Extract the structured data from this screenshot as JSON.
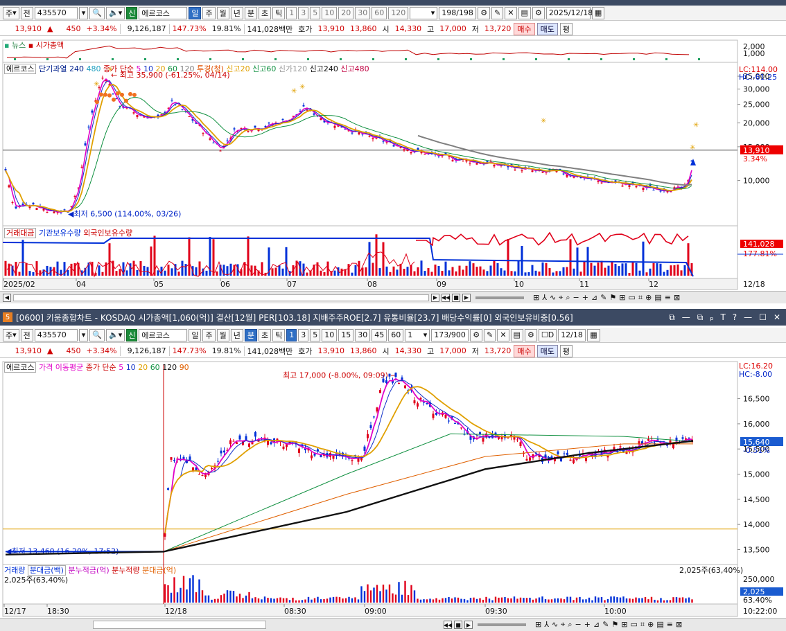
{
  "top": {
    "toolbar": {
      "type": "주",
      "prev": "전",
      "code": "435570",
      "market_badge": "신",
      "name": "에르코스",
      "periods": [
        "일",
        "주",
        "월",
        "년",
        "분",
        "초",
        "틱"
      ],
      "active_period": "일",
      "nums": [
        "1",
        "3",
        "5",
        "10",
        "20",
        "30",
        "60",
        "120"
      ],
      "count": "198/198",
      "date": "2025/12/18"
    },
    "quote": {
      "price": "13,910",
      "arrow": "▲",
      "change": "450",
      "pct": "+3.34%",
      "volume": "9,126,187",
      "vol_ratio": "147.73%",
      "turnover": "19.81%",
      "amount": "141,028백만",
      "hoga_label": "호가",
      "ask": "13,910",
      "bid": "13,860",
      "open_label": "시",
      "open": "14,330",
      "high_label": "고",
      "high": "17,000",
      "low_label": "저",
      "low": "13,720",
      "buy": "매수",
      "sell": "매도",
      "eval": "평"
    },
    "news_panel": {
      "news": "뉴스",
      "mcap": "시가총액",
      "ticks": [
        "2,000",
        "1,000"
      ]
    },
    "legend": {
      "stock": "에르코스",
      "sma": "단기과열",
      "n1": "240",
      "n2": "480",
      "ma_label": "종가 단순",
      "m5": "5",
      "m10": "10",
      "m20": "20",
      "m60": "60",
      "m120": "120",
      "tg": "투경(청)",
      "s20": "신고20",
      "s60": "신고60",
      "s120": "신가120",
      "s240": "신고240",
      "s480": "신고480"
    },
    "right_top": {
      "lc": "LC:114.00",
      "hc": "HC:-61.25"
    },
    "price_ticks": [
      "35,000",
      "30,000",
      "25,000",
      "20,000",
      "15,000",
      "10,000"
    ],
    "last_price": "13,910",
    "last_pct": "3.34%",
    "high_note": "최고 35,900 (-61.25%, 04/14)",
    "low_note": "최저 6,500 (114.00%, 03/26)",
    "vol_legend": {
      "a": "거래대금",
      "b": "기관보유수량",
      "c": "외국인보유수량"
    },
    "vol_right": {
      "v1": "141,028",
      "v2": "177.81%"
    },
    "x_labels": [
      "2025/02",
      "04",
      "05",
      "06",
      "07",
      "08",
      "09",
      "10",
      "11",
      "12"
    ],
    "x_right": "12/18"
  },
  "titlebar": {
    "num": "5",
    "text": "[0600] 키움종합차트 - KOSDAQ 시가총액[1,060(억)] 결산[12월] PER[103.18] 지배주주ROE[2.7] 유통비율[23.7] 배당수익률[0] 외국인보유비중[0.56]",
    "controls": [
      "⧉",
      "—",
      "⧉",
      "ₚ",
      "T",
      "?",
      "—",
      "☐",
      "✕"
    ]
  },
  "bottom": {
    "toolbar": {
      "type": "주",
      "prev": "전",
      "code": "435570",
      "market_badge": "신",
      "name": "에르코스",
      "periods": [
        "일",
        "주",
        "월",
        "년",
        "분",
        "초",
        "틱"
      ],
      "active_period": "분",
      "nums": [
        "1",
        "3",
        "5",
        "10",
        "15",
        "30",
        "45",
        "60"
      ],
      "interval": "1",
      "count": "173/900",
      "d_label": "D",
      "date": "12/18"
    },
    "legend": {
      "stock": "에르코스",
      "ma": "가격 이동평균",
      "ma_label": "종가 단순",
      "m5": "5",
      "m10": "10",
      "m20": "20",
      "m60": "60",
      "m120": "120",
      "m90": "90"
    },
    "right_top": {
      "lc": "LC:16.20",
      "hc": "HC:-8.00"
    },
    "price_ticks": [
      "16,500",
      "16,000",
      "15,500",
      "15,000",
      "14,500",
      "14,000",
      "13,500"
    ],
    "last_price": "15,640",
    "last_pct": "-0.51%",
    "high_note": "최고 17,000 (-8.00%, 09:09)",
    "low_note": "최저 13,460 (16.20%, 17:52)",
    "vol_legend": {
      "a": "거래량",
      "b": "분대금(백)",
      "c": "분누적금(억)",
      "d": "분누적량",
      "e": "분대금(억)"
    },
    "vol_left": "2,025주(63,40%)",
    "vol_top_right": "2,025주(63,40%)",
    "vol_ticks": [
      "250,000"
    ],
    "vol_right": {
      "v1": "2,025",
      "v2": "63.40%"
    },
    "x_labels": [
      "12/17",
      "18:30",
      "12/18",
      "08:30",
      "09:00",
      "09:30",
      "10:00"
    ],
    "x_right": "10:22:00"
  },
  "colors": {
    "up": "#e0001a",
    "down": "#0030d8",
    "ma5": "#e000c8",
    "ma10": "#1030c8",
    "ma20": "#e0a000",
    "ma60": "#109040",
    "ma120": "#808080",
    "mcap": "#c00000"
  }
}
